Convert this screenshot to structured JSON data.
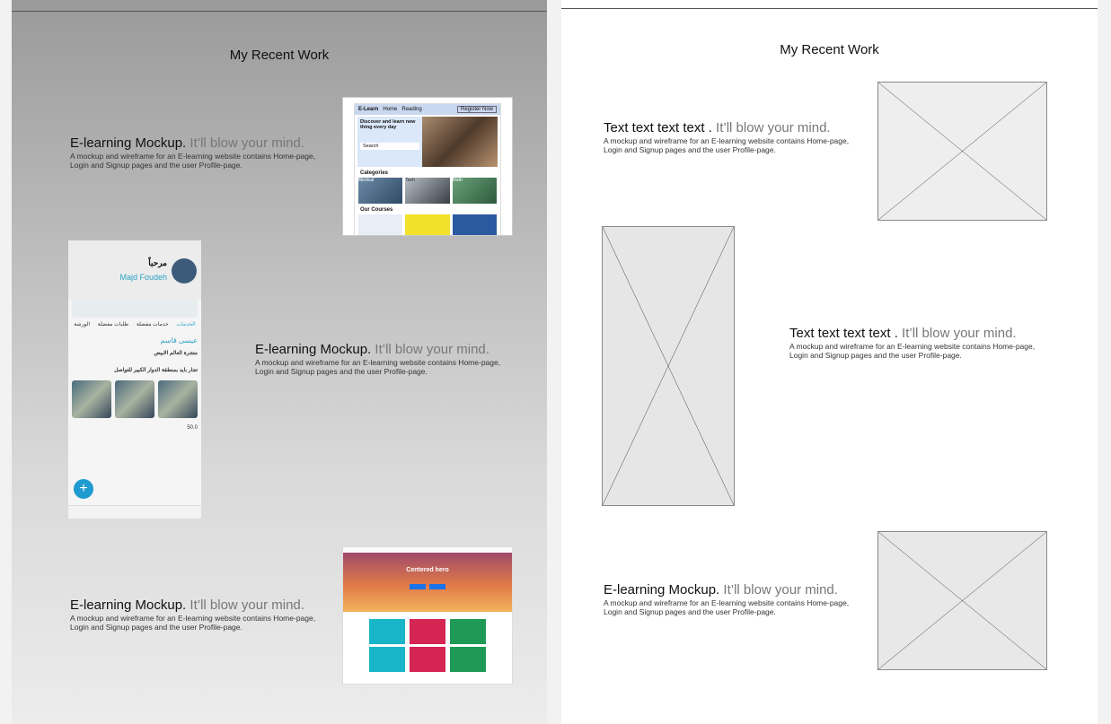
{
  "left_frame": {
    "title": "My Recent Work",
    "projects": [
      {
        "headline_strong": "E-learning Mockup.",
        "headline_muted": " It’ll blow your mind.",
        "description": "A mockup and wireframe for an E-learning website contains Home-page, Login and Signup pages and the user Profile-page."
      },
      {
        "headline_strong": "E-learning Mockup.",
        "headline_muted": " It’ll blow your mind.",
        "description": "A mockup and wireframe for an E-learning website contains Home-page, Login and Signup pages and the user Profile-page."
      },
      {
        "headline_strong": "E-learning Mockup.",
        "headline_muted": " It’ll blow your mind.",
        "description": "A mockup and wireframe for an E-learning website contains Home-page, Login and Signup pages and the user Profile-page."
      }
    ],
    "elearn_thumb": {
      "brand": "E-Learn",
      "nav": [
        "Home",
        "Reading"
      ],
      "register": "Register Now",
      "hero_text": "Discover and learn new thing every day",
      "search": "Search",
      "categories_heading": "Categories",
      "categories": [
        "Medical",
        "Tech",
        "Math"
      ],
      "courses_heading": "Our Courses"
    },
    "phone_thumb": {
      "hello": "مرحباً",
      "user_name": "Majd Foudeh",
      "tabs": [
        "الخدمات",
        "خدمات مفضلة",
        "طلبات مفضلة",
        "الورشة"
      ],
      "poster": "عيسى قاسم",
      "post_title": "متجرة العالم الابيض",
      "post_text": "تجار بايد بمنطقة الدوار الكبير للتواصل",
      "price": "50.0",
      "fab": "+"
    },
    "hero_thumb": {
      "title": "Centered hero"
    }
  },
  "right_frame": {
    "title": "My Recent Work",
    "projects": [
      {
        "headline_strong": "Text text text text .",
        "headline_muted": " It’ll blow your mind.",
        "description": "A mockup and wireframe for an E-learning website contains Home-page, Login and Signup pages and the user Profile-page."
      },
      {
        "headline_strong": "Text text text text .",
        "headline_muted": " It’ll blow your mind.",
        "description": "A mockup and wireframe for an E-learning website contains Home-page, Login and Signup pages and the user Profile-page."
      },
      {
        "headline_strong": "E-learning Mockup.",
        "headline_muted": " It’ll blow your mind.",
        "description": "A mockup and wireframe for an E-learning website contains Home-page, Login and Signup pages and the user Profile-page."
      }
    ]
  }
}
